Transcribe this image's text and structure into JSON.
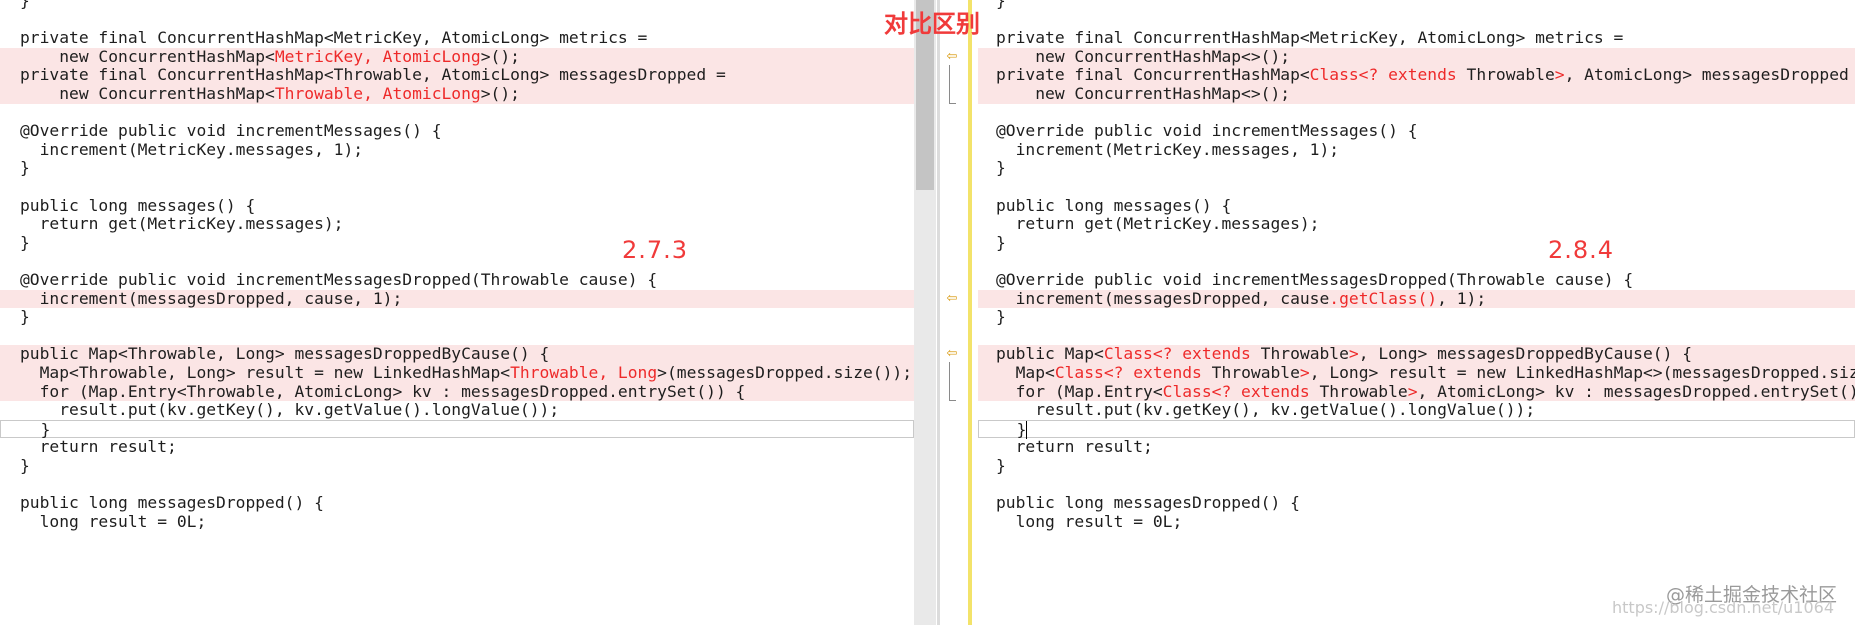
{
  "overlay_title": "对比区别",
  "watermark": "@稀土掘金技术社区",
  "watermark_url": "https://blog.csdn.net/u1064",
  "left": {
    "version": "2.7.3",
    "lines": [
      {
        "segs": [
          {
            "t": "}"
          }
        ]
      },
      {
        "segs": [
          {
            "t": ""
          }
        ]
      },
      {
        "segs": [
          {
            "t": "private final ConcurrentHashMap<MetricKey, AtomicLong> metrics ="
          }
        ]
      },
      {
        "diff": true,
        "segs": [
          {
            "t": "    new ConcurrentHashMap<"
          },
          {
            "t": "MetricKey, AtomicLong",
            "hl": true
          },
          {
            "t": ">();"
          }
        ]
      },
      {
        "diff": true,
        "segs": [
          {
            "t": "private final ConcurrentHashMap<Throwable, AtomicLong> messagesDropped ="
          }
        ]
      },
      {
        "diff": true,
        "segs": [
          {
            "t": "    new ConcurrentHashMap<"
          },
          {
            "t": "Throwable, AtomicLong",
            "hl": true
          },
          {
            "t": ">();"
          }
        ]
      },
      {
        "segs": [
          {
            "t": ""
          }
        ]
      },
      {
        "segs": [
          {
            "t": "@Override public void incrementMessages() {"
          }
        ]
      },
      {
        "segs": [
          {
            "t": "  increment(MetricKey.messages, 1);"
          }
        ]
      },
      {
        "segs": [
          {
            "t": "}"
          }
        ]
      },
      {
        "segs": [
          {
            "t": ""
          }
        ]
      },
      {
        "segs": [
          {
            "t": "public long messages() {"
          }
        ]
      },
      {
        "segs": [
          {
            "t": "  return get(MetricKey.messages);"
          }
        ]
      },
      {
        "segs": [
          {
            "t": "}"
          }
        ]
      },
      {
        "segs": [
          {
            "t": ""
          }
        ]
      },
      {
        "segs": [
          {
            "t": "@Override public void incrementMessagesDropped(Throwable cause) {"
          }
        ]
      },
      {
        "diff": true,
        "segs": [
          {
            "t": "  increment(messagesDropped, cause, 1);"
          }
        ]
      },
      {
        "segs": [
          {
            "t": "}"
          }
        ]
      },
      {
        "segs": [
          {
            "t": ""
          }
        ]
      },
      {
        "diff": true,
        "segs": [
          {
            "t": "public Map<Throwable, Long> messagesDroppedByCause() {"
          }
        ]
      },
      {
        "diff": true,
        "segs": [
          {
            "t": "  Map<Throwable, Long> result = new LinkedHashMap<"
          },
          {
            "t": "Throwable, Long",
            "hl": true
          },
          {
            "t": ">(messagesDropped.size());"
          }
        ]
      },
      {
        "diff": true,
        "segs": [
          {
            "t": "  for (Map.Entry<Throwable, AtomicLong> kv : messagesDropped.entrySet()) {"
          }
        ]
      },
      {
        "segs": [
          {
            "t": "    result.put(kv.getKey(), kv.getValue().longValue());"
          }
        ]
      },
      {
        "cursor": true,
        "segs": [
          {
            "t": "  }"
          }
        ]
      },
      {
        "segs": [
          {
            "t": "  return result;"
          }
        ]
      },
      {
        "segs": [
          {
            "t": "}"
          }
        ]
      },
      {
        "segs": [
          {
            "t": ""
          }
        ]
      },
      {
        "segs": [
          {
            "t": "public long messagesDropped() {"
          }
        ]
      },
      {
        "segs": [
          {
            "t": "  long result = 0L;"
          }
        ]
      }
    ]
  },
  "right": {
    "version": "2.8.4",
    "lines": [
      {
        "segs": [
          {
            "t": "}"
          }
        ]
      },
      {
        "segs": [
          {
            "t": ""
          }
        ]
      },
      {
        "segs": [
          {
            "t": "private final ConcurrentHashMap<MetricKey, AtomicLong> metrics ="
          }
        ]
      },
      {
        "diff": true,
        "segs": [
          {
            "t": "    new ConcurrentHashMap<>();"
          }
        ]
      },
      {
        "diff": true,
        "segs": [
          {
            "t": "private final ConcurrentHashMap<"
          },
          {
            "t": "Class<? extends",
            "hl": true
          },
          {
            "t": " Throwable"
          },
          {
            "t": ">",
            "hl": true
          },
          {
            "t": ", AtomicLong> messagesDropped ="
          }
        ]
      },
      {
        "diff": true,
        "segs": [
          {
            "t": "    new ConcurrentHashMap<>();"
          }
        ]
      },
      {
        "segs": [
          {
            "t": ""
          }
        ]
      },
      {
        "segs": [
          {
            "t": "@Override public void incrementMessages() {"
          }
        ]
      },
      {
        "segs": [
          {
            "t": "  increment(MetricKey.messages, 1);"
          }
        ]
      },
      {
        "segs": [
          {
            "t": "}"
          }
        ]
      },
      {
        "segs": [
          {
            "t": ""
          }
        ]
      },
      {
        "segs": [
          {
            "t": "public long messages() {"
          }
        ]
      },
      {
        "segs": [
          {
            "t": "  return get(MetricKey.messages);"
          }
        ]
      },
      {
        "segs": [
          {
            "t": "}"
          }
        ]
      },
      {
        "segs": [
          {
            "t": ""
          }
        ]
      },
      {
        "segs": [
          {
            "t": "@Override public void incrementMessagesDropped(Throwable cause) {"
          }
        ]
      },
      {
        "diff": true,
        "segs": [
          {
            "t": "  increment(messagesDropped, cause"
          },
          {
            "t": ".getClass()",
            "hl": true
          },
          {
            "t": ", 1);"
          }
        ]
      },
      {
        "segs": [
          {
            "t": "}"
          }
        ]
      },
      {
        "segs": [
          {
            "t": ""
          }
        ]
      },
      {
        "diff": true,
        "segs": [
          {
            "t": "public Map<"
          },
          {
            "t": "Class<? extends",
            "hl": true
          },
          {
            "t": " Throwable"
          },
          {
            "t": ">",
            "hl": true
          },
          {
            "t": ", Long> messagesDroppedByCause() {"
          }
        ]
      },
      {
        "diff": true,
        "segs": [
          {
            "t": "  Map<"
          },
          {
            "t": "Class<? extends",
            "hl": true
          },
          {
            "t": " Throwable"
          },
          {
            "t": ">",
            "hl": true
          },
          {
            "t": ", Long> result = new LinkedHashMap<>(messagesDropped.size());"
          }
        ]
      },
      {
        "diff": true,
        "segs": [
          {
            "t": "  for (Map.Entry<"
          },
          {
            "t": "Class<? extends",
            "hl": true
          },
          {
            "t": " Throwable"
          },
          {
            "t": ">",
            "hl": true
          },
          {
            "t": ", AtomicLong> kv : messagesDropped.entrySet()) {"
          }
        ]
      },
      {
        "segs": [
          {
            "t": "    result.put(kv.getKey(), kv.getValue().longValue());"
          }
        ]
      },
      {
        "cursor": true,
        "caret": true,
        "segs": [
          {
            "t": "  }"
          }
        ]
      },
      {
        "segs": [
          {
            "t": "  return result;"
          }
        ]
      },
      {
        "segs": [
          {
            "t": "}"
          }
        ]
      },
      {
        "segs": [
          {
            "t": ""
          }
        ]
      },
      {
        "segs": [
          {
            "t": "public long messagesDropped() {"
          }
        ]
      },
      {
        "segs": [
          {
            "t": "  long result = 0L;"
          }
        ]
      }
    ]
  },
  "gutter_arrows": [
    {
      "line": 3,
      "icon": "left-arrow-icon"
    },
    {
      "line": 16,
      "icon": "left-arrow-icon"
    },
    {
      "line": 19,
      "icon": "left-arrow-icon"
    }
  ],
  "colors": {
    "diff_bg": "#fbe5e5",
    "highlight": "#ee2a2a",
    "gutter_line": "#f3e36a"
  }
}
